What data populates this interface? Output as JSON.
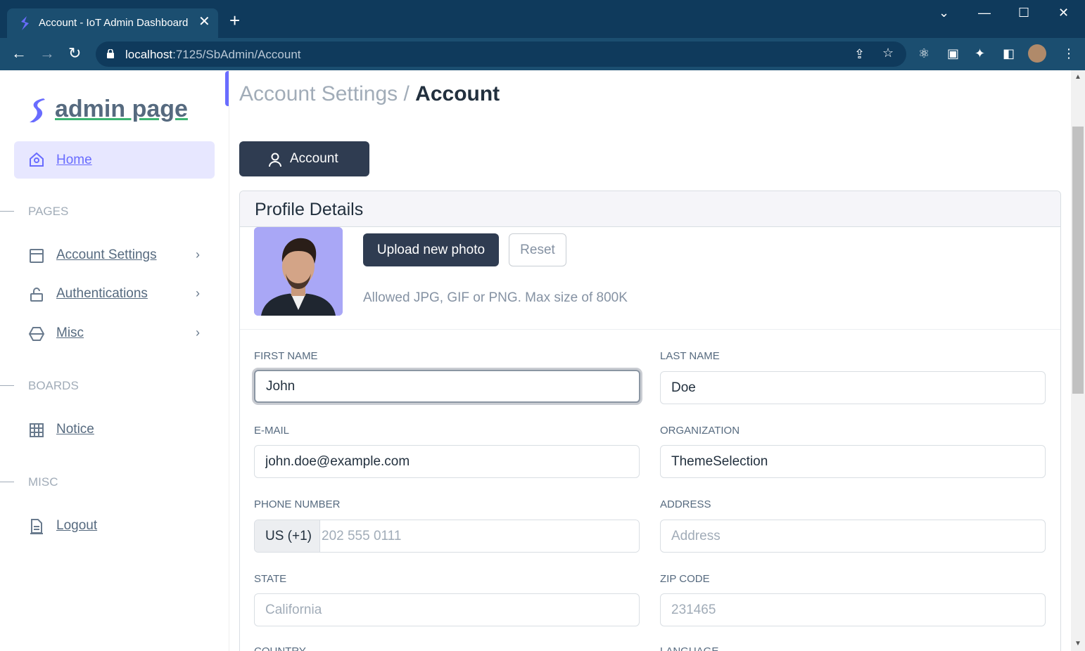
{
  "browser": {
    "tab_title": "Account - IoT Admin Dashboard",
    "tab_close": "✕",
    "new_tab": "+",
    "url_host": "localhost",
    "url_path": ":7125/SbAdmin/Account"
  },
  "sidebar": {
    "brand": "admin page",
    "home": "Home",
    "sections": {
      "pages": "PAGES",
      "boards": "BOARDS",
      "misc": "MISC"
    },
    "items": [
      {
        "label": "Account Settings",
        "icon": "layout-icon"
      },
      {
        "label": "Authentications",
        "icon": "lock-icon"
      },
      {
        "label": "Misc",
        "icon": "cube-icon"
      },
      {
        "label": "Notice",
        "icon": "table-icon"
      },
      {
        "label": "Logout",
        "icon": "document-icon"
      }
    ],
    "accent": "#696cff"
  },
  "main": {
    "breadcrumb_parent": "Account Settings /",
    "breadcrumb_current": "Account",
    "tab_account": "Account",
    "card_title": "Profile Details",
    "upload_button": "Upload new photo",
    "reset_button": "Reset",
    "upload_hint": "Allowed JPG, GIF or PNG. Max size of 800K",
    "fields": {
      "first_name": {
        "label": "FIRST NAME",
        "value": "John"
      },
      "last_name": {
        "label": "LAST NAME",
        "value": "Doe"
      },
      "email": {
        "label": "E-MAIL",
        "value": "john.doe@example.com"
      },
      "organization": {
        "label": "ORGANIZATION",
        "value": "ThemeSelection"
      },
      "phone": {
        "label": "PHONE NUMBER",
        "prefix": "US (+1)",
        "placeholder": "202 555 0111"
      },
      "address": {
        "label": "ADDRESS",
        "placeholder": "Address"
      },
      "state": {
        "label": "STATE",
        "placeholder": "California"
      },
      "zip": {
        "label": "ZIP CODE",
        "placeholder": "231465"
      },
      "country": {
        "label": "COUNTRY"
      },
      "language": {
        "label": "LANGUAGE"
      }
    }
  }
}
